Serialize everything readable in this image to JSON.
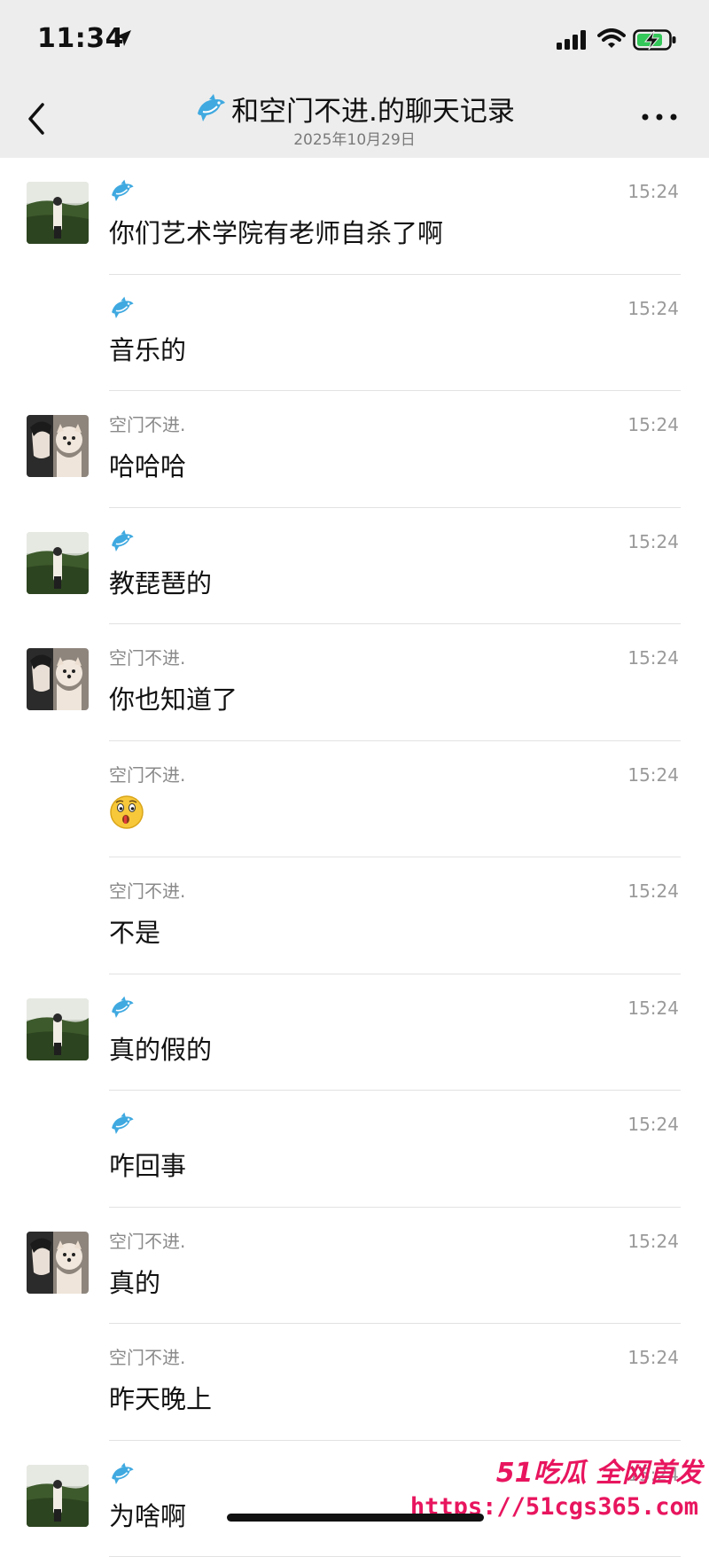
{
  "status_bar": {
    "time": "11:34"
  },
  "nav": {
    "title": "和空门不进.的聊天记录",
    "date": "2025年10月29日"
  },
  "messages": [
    {
      "sender": "",
      "sender_icon": "dolphin-icon",
      "avatar": "landscape-avatar",
      "time": "15:24",
      "text": "你们艺术学院有老师自杀了啊"
    },
    {
      "sender": "",
      "sender_icon": "dolphin-icon",
      "avatar": "",
      "time": "15:24",
      "text": "音乐的"
    },
    {
      "sender": "空门不进.",
      "sender_icon": "",
      "avatar": "dog-avatar",
      "time": "15:24",
      "text": "哈哈哈"
    },
    {
      "sender": "",
      "sender_icon": "dolphin-icon",
      "avatar": "landscape-avatar",
      "time": "15:24",
      "text": "教琵琶的"
    },
    {
      "sender": "空门不进.",
      "sender_icon": "",
      "avatar": "dog-avatar",
      "time": "15:24",
      "text": "你也知道了"
    },
    {
      "sender": "空门不进.",
      "sender_icon": "",
      "avatar": "",
      "time": "15:24",
      "text": "",
      "emoji": "surprised-face-emoji"
    },
    {
      "sender": "空门不进.",
      "sender_icon": "",
      "avatar": "",
      "time": "15:24",
      "text": "不是"
    },
    {
      "sender": "",
      "sender_icon": "dolphin-icon",
      "avatar": "landscape-avatar",
      "time": "15:24",
      "text": "真的假的"
    },
    {
      "sender": "",
      "sender_icon": "dolphin-icon",
      "avatar": "",
      "time": "15:24",
      "text": "咋回事"
    },
    {
      "sender": "空门不进.",
      "sender_icon": "",
      "avatar": "dog-avatar",
      "time": "15:24",
      "text": "真的"
    },
    {
      "sender": "空门不进.",
      "sender_icon": "",
      "avatar": "",
      "time": "15:24",
      "text": "昨天晚上"
    },
    {
      "sender": "",
      "sender_icon": "dolphin-icon",
      "avatar": "landscape-avatar",
      "time": "15:24",
      "text": "为啥啊"
    }
  ],
  "watermark": {
    "line1": "51吃瓜 全网首发",
    "line2": "https://51cgs365.com"
  },
  "colors": {
    "header_bg": "#ededed",
    "watermark": "#e8155e",
    "dolphin": "#3fa9e0"
  }
}
